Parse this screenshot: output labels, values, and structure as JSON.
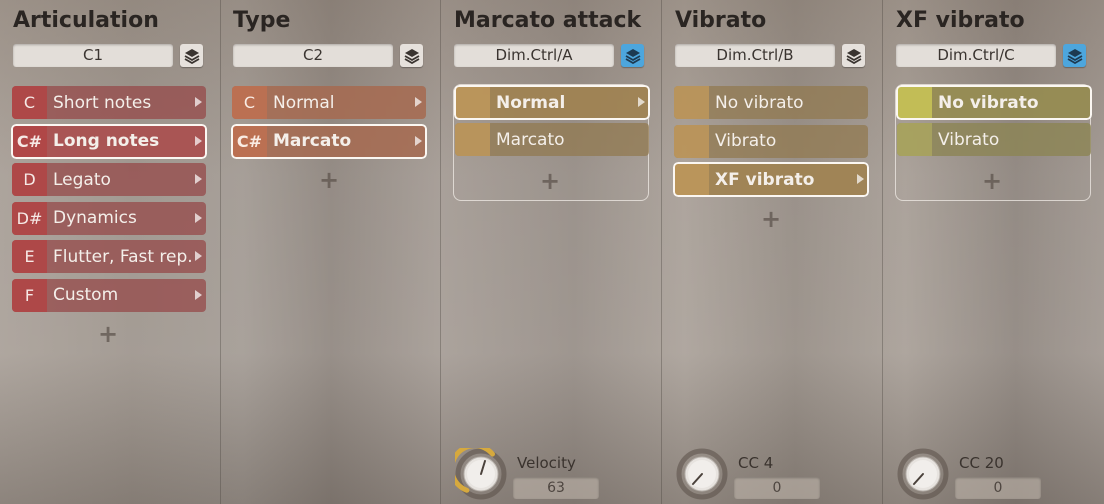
{
  "columns": [
    {
      "title": "Articulation",
      "ctrl": "C1",
      "layer_active": false,
      "items": [
        {
          "key": "C",
          "label": "Short notes"
        },
        {
          "key": "C#",
          "label": "Long notes"
        },
        {
          "key": "D",
          "label": "Legato"
        },
        {
          "key": "D#",
          "label": "Dynamics"
        },
        {
          "key": "E",
          "label": "Flutter, Fast rep."
        },
        {
          "key": "F",
          "label": "Custom"
        }
      ],
      "selected": "Long notes"
    },
    {
      "title": "Type",
      "ctrl": "C2",
      "layer_active": false,
      "items": [
        {
          "key": "C",
          "label": "Normal"
        },
        {
          "key": "C#",
          "label": "Marcato"
        }
      ],
      "selected": "Marcato"
    },
    {
      "title": "Marcato attack",
      "ctrl": "Dim.Ctrl/A",
      "layer_active": true,
      "items": [
        {
          "label": "Normal"
        },
        {
          "label": "Marcato"
        }
      ],
      "selected": "Normal",
      "knob": {
        "label": "Velocity",
        "value": "63"
      }
    },
    {
      "title": "Vibrato",
      "ctrl": "Dim.Ctrl/B",
      "layer_active": false,
      "items": [
        {
          "label": "No vibrato"
        },
        {
          "label": "Vibrato"
        },
        {
          "label": "XF vibrato"
        }
      ],
      "selected": "XF vibrato",
      "knob": {
        "label": "CC 4",
        "value": "0"
      }
    },
    {
      "title": "XF vibrato",
      "ctrl": "Dim.Ctrl/C",
      "layer_active": true,
      "items": [
        {
          "label": "No vibrato"
        },
        {
          "label": "Vibrato"
        }
      ],
      "selected": "No vibrato",
      "knob": {
        "label": "CC 20",
        "value": "0"
      }
    }
  ],
  "icons": {
    "layer": "layers-icon",
    "add": "plus-icon",
    "expand": "chevron-right-icon"
  },
  "colors": {
    "layer_active": "#4da6dd",
    "knob_arc": "#d6a93e"
  },
  "add_symbol": "+"
}
